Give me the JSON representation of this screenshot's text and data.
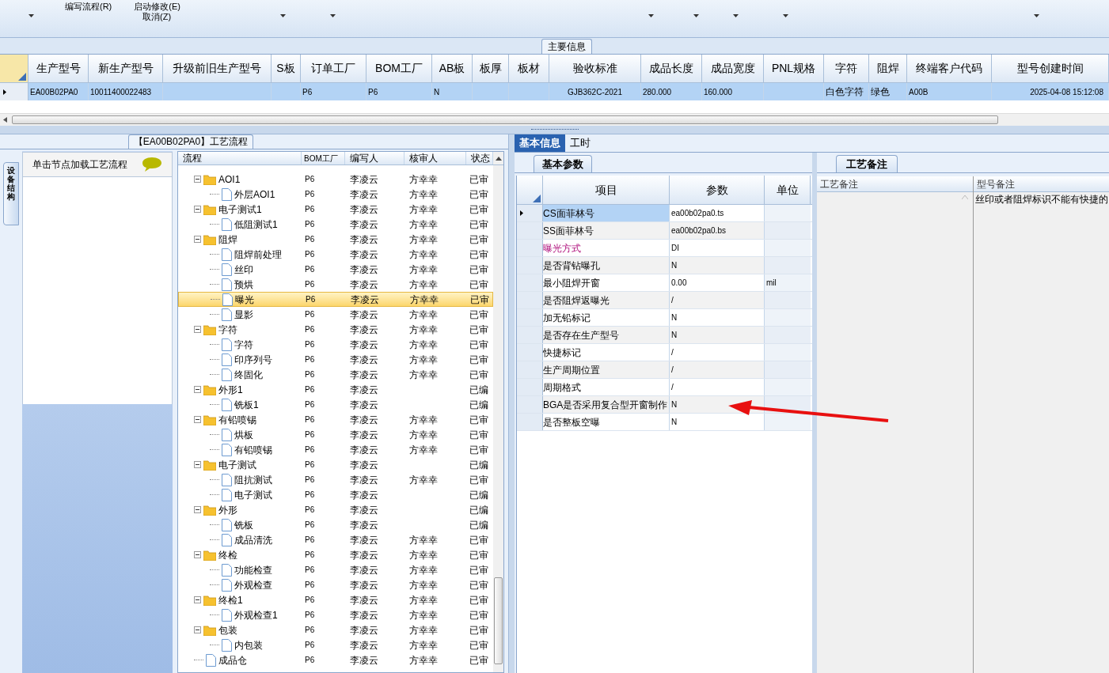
{
  "toolbar": {
    "items": [
      {
        "label": "编写流程(R)"
      },
      {
        "label": "启动修改(E)"
      },
      {
        "label": "取消(Z)"
      }
    ]
  },
  "main_section": {
    "title": "主要信息"
  },
  "main_table": {
    "columns": [
      "生产型号",
      "新生产型号",
      "升级前旧生产型号",
      "S板",
      "订单工厂",
      "BOM工厂",
      "AB板",
      "板厚",
      "板材",
      "验收标准",
      "成品长度",
      "成品宽度",
      "PNL规格",
      "字符",
      "阻焊",
      "终端客户代码",
      "型号创建时间"
    ],
    "rows": [
      {
        "selected": true,
        "cells": [
          "EA00B02PA0",
          "10011400022483",
          "",
          "",
          "P6",
          "P6",
          "N",
          "",
          "",
          "GJB362C-2021",
          "280.000",
          "160.000",
          "",
          "白色字符",
          "绿色",
          "A00B",
          "2025-04-08 15:12:08"
        ]
      }
    ]
  },
  "flow_panel": {
    "title": "【EA00B02PA0】工艺流程",
    "side_tab": "设备结构",
    "hint": "单击节点加载工艺流程",
    "columns": [
      "流程",
      "BOM工厂",
      "编写人",
      "核审人",
      "状态"
    ],
    "tree": [
      {
        "name": "AOI1",
        "factory": "P6",
        "writer": "李凌云",
        "reviewer": "方幸幸",
        "status": "已审",
        "selected": false,
        "children": [
          {
            "name": "外层AOI1",
            "factory": "P6",
            "writer": "李凌云",
            "reviewer": "方幸幸",
            "status": "已审",
            "selected": false
          }
        ]
      },
      {
        "name": "电子测试1",
        "factory": "P6",
        "writer": "李凌云",
        "reviewer": "方幸幸",
        "status": "已审",
        "selected": false,
        "children": [
          {
            "name": "低阻测试1",
            "factory": "P6",
            "writer": "李凌云",
            "reviewer": "方幸幸",
            "status": "已审",
            "selected": false
          }
        ]
      },
      {
        "name": "阻焊",
        "factory": "P6",
        "writer": "李凌云",
        "reviewer": "方幸幸",
        "status": "已审",
        "selected": false,
        "children": [
          {
            "name": "阻焊前处理",
            "factory": "P6",
            "writer": "李凌云",
            "reviewer": "方幸幸",
            "status": "已审",
            "selected": false
          },
          {
            "name": "丝印",
            "factory": "P6",
            "writer": "李凌云",
            "reviewer": "方幸幸",
            "status": "已审",
            "selected": false
          },
          {
            "name": "预烘",
            "factory": "P6",
            "writer": "李凌云",
            "reviewer": "方幸幸",
            "status": "已审",
            "selected": false
          },
          {
            "name": "曝光",
            "factory": "P6",
            "writer": "李凌云",
            "reviewer": "方幸幸",
            "status": "已审",
            "selected": true
          },
          {
            "name": "显影",
            "factory": "P6",
            "writer": "李凌云",
            "reviewer": "方幸幸",
            "status": "已审",
            "selected": false
          }
        ]
      },
      {
        "name": "字符",
        "factory": "P6",
        "writer": "李凌云",
        "reviewer": "方幸幸",
        "status": "已审",
        "selected": false,
        "children": [
          {
            "name": "字符",
            "factory": "P6",
            "writer": "李凌云",
            "reviewer": "方幸幸",
            "status": "已审",
            "selected": false
          },
          {
            "name": "印序列号",
            "factory": "P6",
            "writer": "李凌云",
            "reviewer": "方幸幸",
            "status": "已审",
            "selected": false
          },
          {
            "name": "终固化",
            "factory": "P6",
            "writer": "李凌云",
            "reviewer": "方幸幸",
            "status": "已审",
            "selected": false
          }
        ]
      },
      {
        "name": "外形1",
        "factory": "P6",
        "writer": "李凌云",
        "status": "已编",
        "selected": false,
        "children": [
          {
            "name": "铣板1",
            "factory": "P6",
            "writer": "李凌云",
            "status": "已编",
            "selected": false
          }
        ]
      },
      {
        "name": "有铅喷锡",
        "factory": "P6",
        "writer": "李凌云",
        "reviewer": "方幸幸",
        "status": "已审",
        "selected": false,
        "children": [
          {
            "name": "烘板",
            "factory": "P6",
            "writer": "李凌云",
            "reviewer": "方幸幸",
            "status": "已审",
            "selected": false
          },
          {
            "name": "有铅喷锡",
            "factory": "P6",
            "writer": "李凌云",
            "reviewer": "方幸幸",
            "status": "已审",
            "selected": false
          }
        ]
      },
      {
        "name": "电子测试",
        "factory": "P6",
        "writer": "李凌云",
        "status": "已编",
        "selected": false,
        "children": [
          {
            "name": "阻抗测试",
            "factory": "P6",
            "writer": "李凌云",
            "reviewer": "方幸幸",
            "status": "已审",
            "selected": false
          },
          {
            "name": "电子测试",
            "factory": "P6",
            "writer": "李凌云",
            "status": "已编",
            "selected": false
          }
        ]
      },
      {
        "name": "外形",
        "factory": "P6",
        "writer": "李凌云",
        "status": "已编",
        "selected": false,
        "children": [
          {
            "name": "铣板",
            "factory": "P6",
            "writer": "李凌云",
            "status": "已编",
            "selected": false
          },
          {
            "name": "成品清洗",
            "factory": "P6",
            "writer": "李凌云",
            "reviewer": "方幸幸",
            "status": "已审",
            "selected": false
          }
        ]
      },
      {
        "name": "终检",
        "factory": "P6",
        "writer": "李凌云",
        "reviewer": "方幸幸",
        "status": "已审",
        "selected": false,
        "children": [
          {
            "name": "功能检查",
            "factory": "P6",
            "writer": "李凌云",
            "reviewer": "方幸幸",
            "status": "已审",
            "selected": false
          },
          {
            "name": "外观检查",
            "factory": "P6",
            "writer": "李凌云",
            "reviewer": "方幸幸",
            "status": "已审",
            "selected": false
          }
        ]
      },
      {
        "name": "终检1",
        "factory": "P6",
        "writer": "李凌云",
        "reviewer": "方幸幸",
        "status": "已审",
        "selected": false,
        "children": [
          {
            "name": "外观检查1",
            "factory": "P6",
            "writer": "李凌云",
            "reviewer": "方幸幸",
            "status": "已审",
            "selected": false
          }
        ]
      },
      {
        "name": "包装",
        "factory": "P6",
        "writer": "李凌云",
        "reviewer": "方幸幸",
        "status": "已审",
        "selected": false,
        "children": [
          {
            "name": "内包装",
            "factory": "P6",
            "writer": "李凌云",
            "reviewer": "方幸幸",
            "status": "已审",
            "selected": false
          }
        ]
      },
      {
        "name": "成品仓",
        "factory": "P6",
        "writer": "李凌云",
        "reviewer": "方幸幸",
        "status": "已审",
        "selected": false
      }
    ]
  },
  "detail_tabs": [
    {
      "label": "基本信息",
      "selected": true
    },
    {
      "label": "工时",
      "selected": false
    }
  ],
  "params_panel": {
    "tab": "基本参数",
    "columns": [
      "项目",
      "参数",
      "单位"
    ],
    "rows": [
      {
        "item": "CS面菲林号",
        "value": "ea00b02pa0.ts",
        "unit": "",
        "selected": true,
        "highlighted": false
      },
      {
        "item": "SS面菲林号",
        "value": "ea00b02pa0.bs",
        "unit": "",
        "selected": false,
        "highlighted": false
      },
      {
        "item": "曝光方式",
        "value": "DI",
        "unit": "",
        "selected": false,
        "highlighted": true
      },
      {
        "item": "是否背钻曝孔",
        "value": "N",
        "unit": "",
        "selected": false,
        "highlighted": false
      },
      {
        "item": "最小阻焊开窗",
        "value": "0.00",
        "unit": "mil",
        "selected": false,
        "highlighted": false
      },
      {
        "item": "是否阻焊返曝光",
        "value": "/",
        "unit": "",
        "selected": false,
        "highlighted": false
      },
      {
        "item": "加无铅标记",
        "value": "N",
        "unit": "",
        "selected": false,
        "highlighted": false
      },
      {
        "item": "是否存在生产型号",
        "value": "N",
        "unit": "",
        "selected": false,
        "highlighted": false
      },
      {
        "item": "快捷标记",
        "value": "/",
        "unit": "",
        "selected": false,
        "highlighted": false
      },
      {
        "item": "生产周期位置",
        "value": "/",
        "unit": "",
        "selected": false,
        "highlighted": false
      },
      {
        "item": "周期格式",
        "value": "/",
        "unit": "",
        "selected": false,
        "highlighted": false
      },
      {
        "item": "BGA是否采用复合型开窗制作",
        "value": "N",
        "unit": "",
        "selected": false,
        "highlighted": false
      },
      {
        "item": "是否整板空曝",
        "value": "N",
        "unit": "",
        "selected": false,
        "highlighted": false
      }
    ]
  },
  "notes_panel": {
    "tab": "工艺备注",
    "columns": [
      "工艺备注",
      "型号备注"
    ],
    "model_note": "丝印或者阻焊标识不能有快捷的"
  },
  "annotation": {
    "kind": "arrow"
  }
}
